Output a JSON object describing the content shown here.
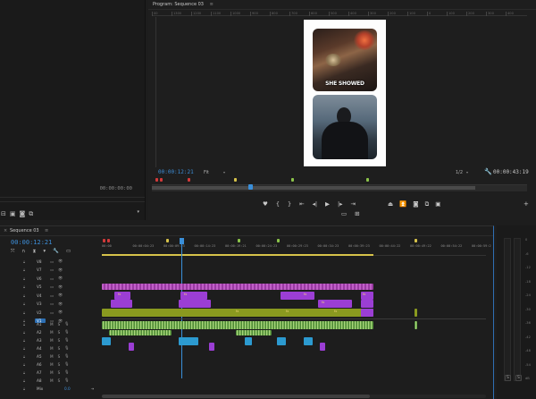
{
  "source": {
    "timecode": "00:00:00:00"
  },
  "program": {
    "title": "Program: Sequence 03",
    "menu_icon": "hamburger-icon",
    "timecode": "00:00:12:21",
    "fit": "Fit",
    "quality": "1/2",
    "duration": "00:00:43:19",
    "caption": "SHE SHOWED",
    "ruler_ticks": [
      "00",
      "1300",
      "1200",
      "1100",
      "1000",
      "900",
      "800",
      "700",
      "600",
      "500",
      "400",
      "300",
      "200",
      "100",
      "0",
      "100",
      "200",
      "300",
      "400"
    ]
  },
  "sequence": {
    "tab_title": "Sequence 03",
    "timecode": "00:00:12:21",
    "ruler_labels": [
      "00:00",
      "00:00:04:23",
      "00:00:09:23",
      "00:00:14:23",
      "00:00:19:21",
      "00:00:24:23",
      "00:00:29:23",
      "00:00:34:23",
      "00:00:39:23",
      "00:00:44:22",
      "00:00:49:22",
      "00:00:54:22",
      "00:00:59:2"
    ],
    "video_tracks": [
      {
        "name": "V8"
      },
      {
        "name": "V7"
      },
      {
        "name": "V6"
      },
      {
        "name": "V5"
      },
      {
        "name": "V4"
      },
      {
        "name": "V3"
      },
      {
        "name": "V2"
      },
      {
        "name": "V1"
      }
    ],
    "audio_tracks": [
      {
        "name": "A1"
      },
      {
        "name": "A2"
      },
      {
        "name": "A3"
      },
      {
        "name": "A4"
      },
      {
        "name": "A5"
      },
      {
        "name": "A6"
      },
      {
        "name": "A7"
      },
      {
        "name": "A8"
      }
    ],
    "mix": {
      "label": "Mix",
      "value": "0.0"
    },
    "track_m": "M",
    "track_s": "S",
    "fx": "fx"
  },
  "meters": {
    "db_labels": [
      "0",
      "-6",
      "-12",
      "-18",
      "-24",
      "-30",
      "-36",
      "-42",
      "-48",
      "-54",
      "dB"
    ],
    "solo_left": "S",
    "solo_right": "S"
  },
  "colors": {
    "accent_blue": "#3d8ed8",
    "marker_red": "#d23a3a",
    "marker_green": "#8bc34a",
    "marker_yellow": "#d6c24a",
    "clip_pink": "#c05fc7",
    "clip_purple": "#9b3ed4",
    "clip_olive": "#8a9a1f",
    "audio_green": "#6fa84a",
    "audio_blue": "#2c9ad0"
  }
}
